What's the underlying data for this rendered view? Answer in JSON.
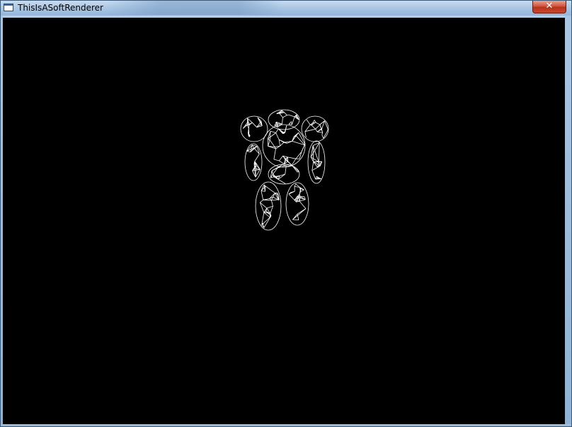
{
  "window": {
    "title": "ThisIsASoftRenderer",
    "close_label": "✕",
    "icons": {
      "app": "app-window-icon",
      "close": "close-icon"
    }
  },
  "viewport": {
    "background": "#000000",
    "wire_color": "#ffffff",
    "model": "robot-wireframe"
  }
}
